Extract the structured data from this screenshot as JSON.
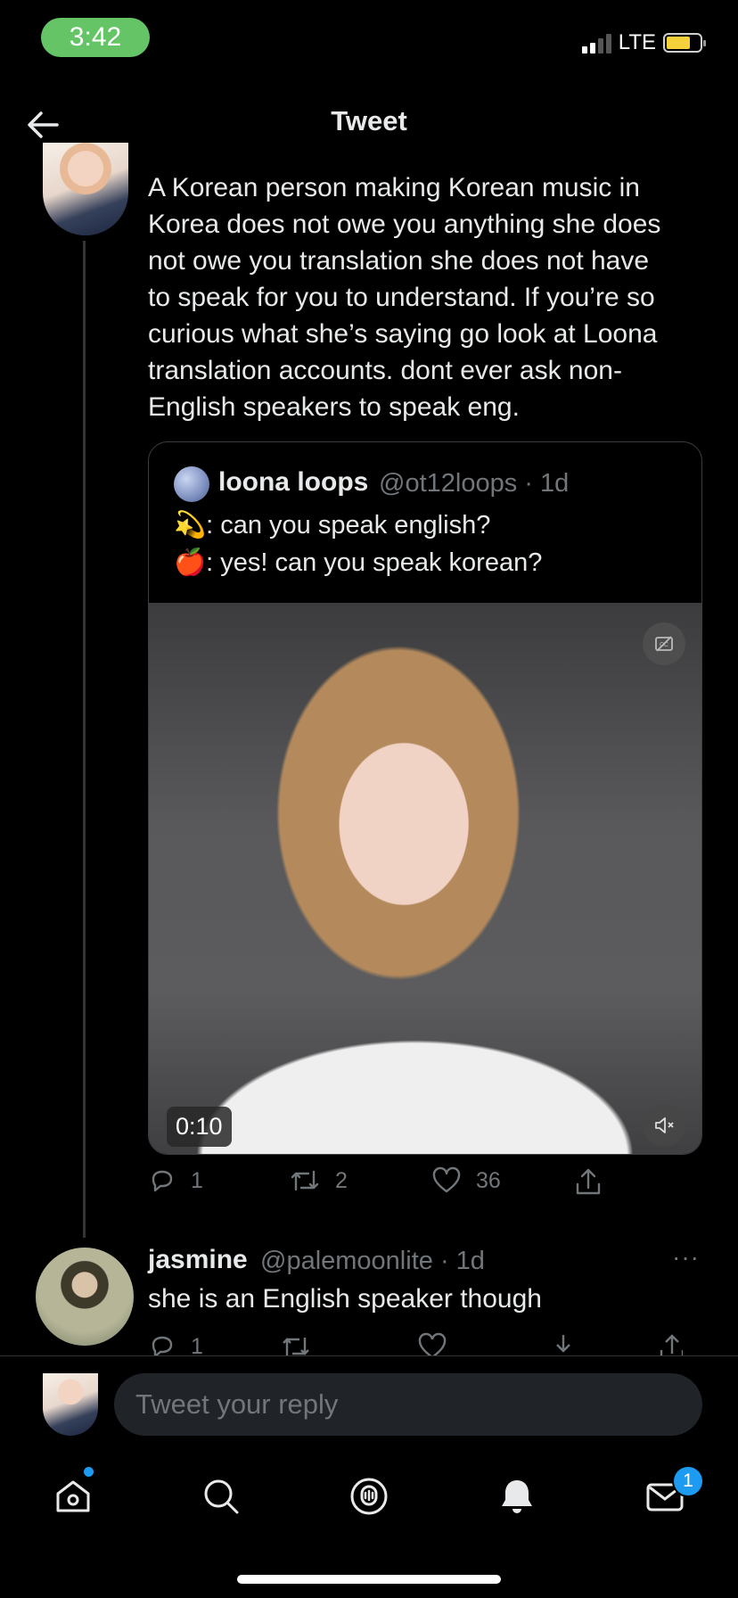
{
  "status_bar": {
    "time": "3:42",
    "network": "LTE"
  },
  "header": {
    "title": "Tweet"
  },
  "tweet": {
    "text": "A Korean person making Korean music in\nKorea does not owe you anything she does\nnot owe you translation she does not have\nto speak for you to understand. If you’re so\ncurious what she’s saying go look at Loona\ntranslation accounts. dont ever ask non-\nEnglish speakers to speak eng.",
    "quote": {
      "name": "loona loops",
      "handle": "@ot12loops · 1d",
      "line1": "💫: can you speak english?",
      "line2": "🍎: yes! can you speak korean?",
      "video_duration": "0:10"
    },
    "stats": {
      "replies": "1",
      "retweets": "2",
      "likes": "36"
    }
  },
  "reply": {
    "name": "jasmine",
    "handle": "@palemoonlite · 1d",
    "more": "···",
    "text": "she is an English speaker though",
    "replies": "1"
  },
  "composer": {
    "placeholder": "Tweet your reply"
  },
  "tabbar": {
    "messages_badge": "1"
  },
  "colors": {
    "accent": "#1d9bf0",
    "background": "#000000",
    "secondary_text": "#71767b",
    "time_pill": "#65c466",
    "battery": "#f4d13b"
  }
}
